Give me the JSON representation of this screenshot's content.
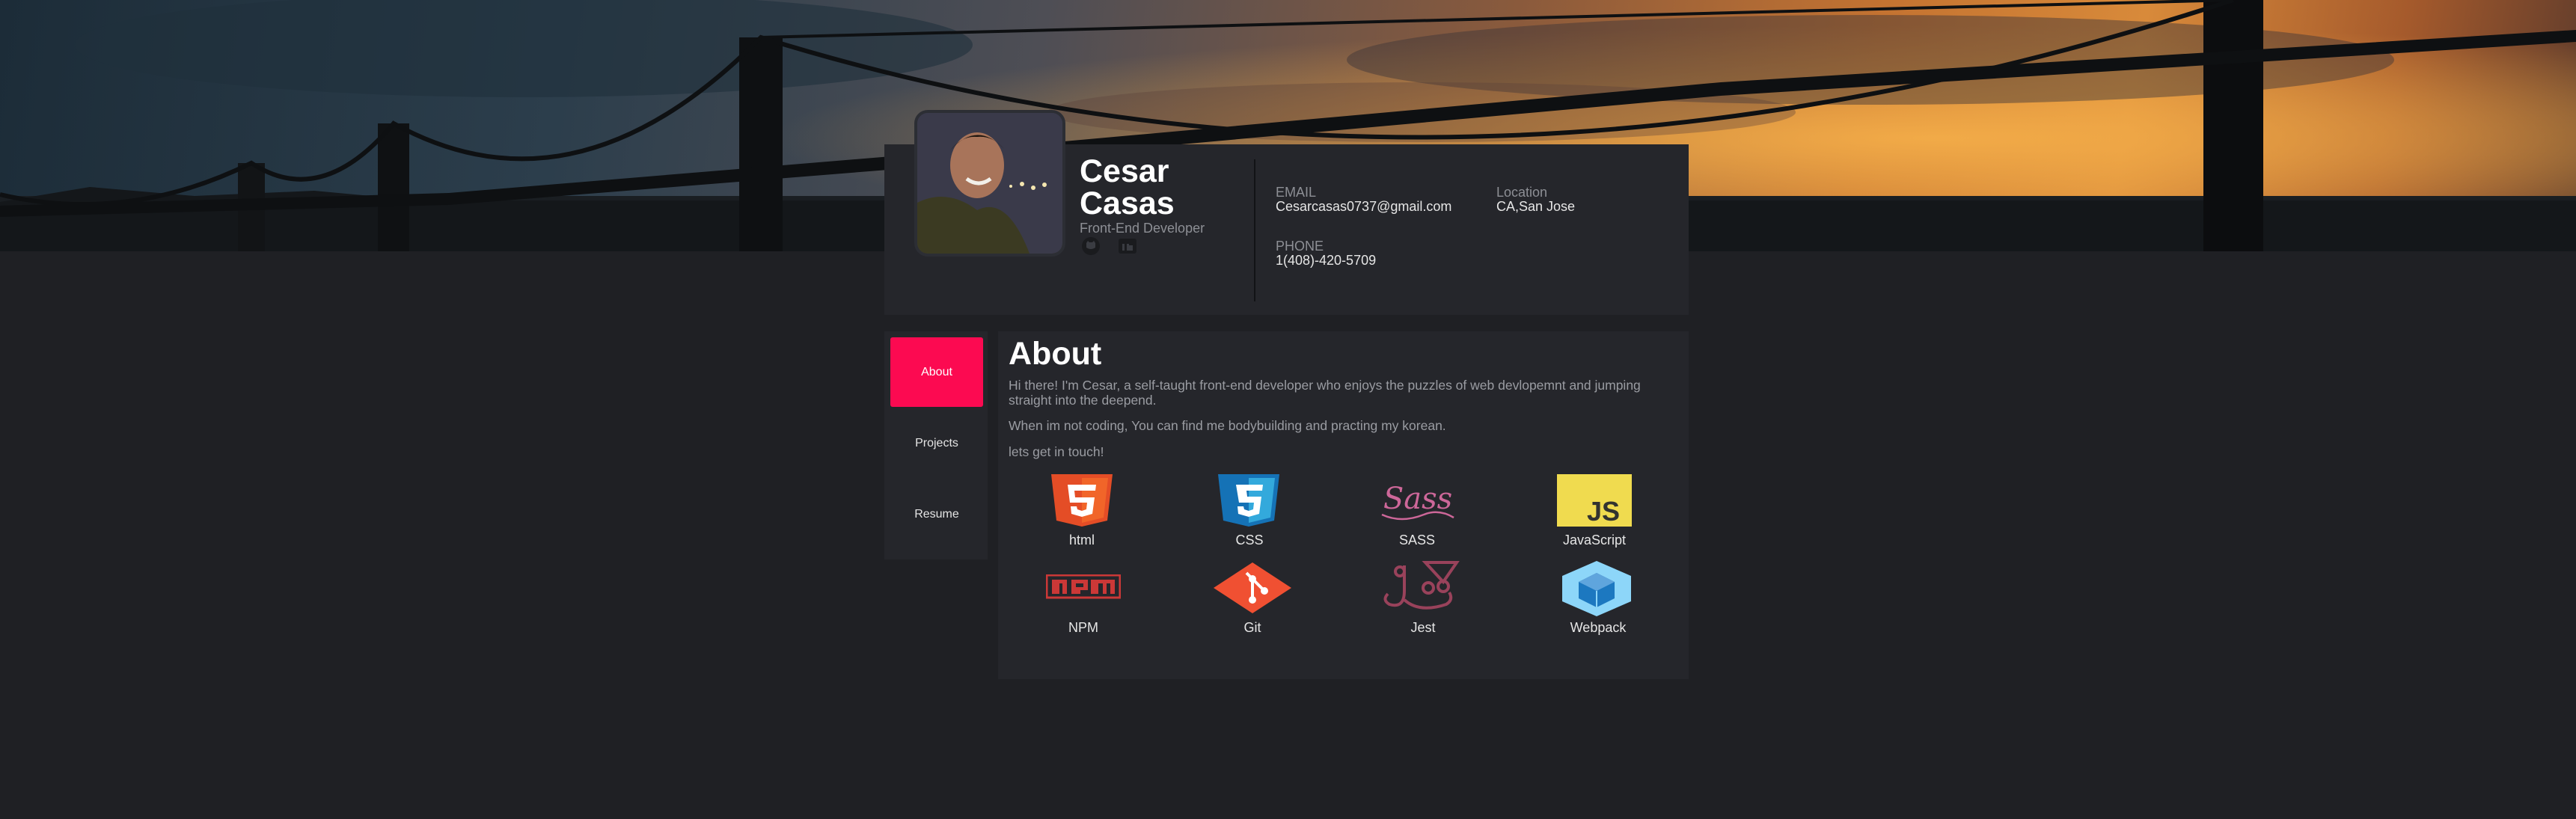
{
  "profile": {
    "first_name": "Cesar",
    "last_name": "Casas",
    "role": "Front-End Developer"
  },
  "contact": {
    "email_label": "EMAIL",
    "email_value": "Cesarcasas0737@gmail.com",
    "location_label": "Location",
    "location_value": "CA,San Jose",
    "phone_label": "PHONE",
    "phone_value": "1(408)-420-5709"
  },
  "social": [
    {
      "icon": "github-icon"
    },
    {
      "icon": "linkedin-icon"
    }
  ],
  "nav": {
    "items": [
      {
        "label": "About",
        "active": true
      },
      {
        "label": "Projects",
        "active": false
      },
      {
        "label": "Resume",
        "active": false
      }
    ]
  },
  "about": {
    "title": "About",
    "paragraphs": [
      "Hi there! I'm Cesar, a self-taught front-end developer who enjoys the puzzles of web devlopemnt and jumping straight into the deepend.",
      "When im not coding, You can find me bodybuilding and practing my korean.",
      "lets get in touch!"
    ]
  },
  "skills": [
    {
      "label": "html",
      "icon": "html5-icon"
    },
    {
      "label": "CSS",
      "icon": "css3-icon"
    },
    {
      "label": "SASS",
      "icon": "sass-icon"
    },
    {
      "label": "JavaScript",
      "icon": "javascript-icon"
    },
    {
      "label": "NPM",
      "icon": "npm-icon"
    },
    {
      "label": "Git",
      "icon": "git-icon"
    },
    {
      "label": "Jest",
      "icon": "jest-icon"
    },
    {
      "label": "Webpack",
      "icon": "webpack-icon"
    }
  ],
  "colors": {
    "background": "#1f2024",
    "card": "#25262b",
    "accent": "#fc0a51",
    "html": "#e44d26",
    "css": "#1572b6",
    "sass": "#cd6799",
    "javascript": "#f0db4f",
    "npm": "#cb3837",
    "git": "#f05032",
    "jest": "#99425b",
    "webpack": "#8dd6f9"
  }
}
